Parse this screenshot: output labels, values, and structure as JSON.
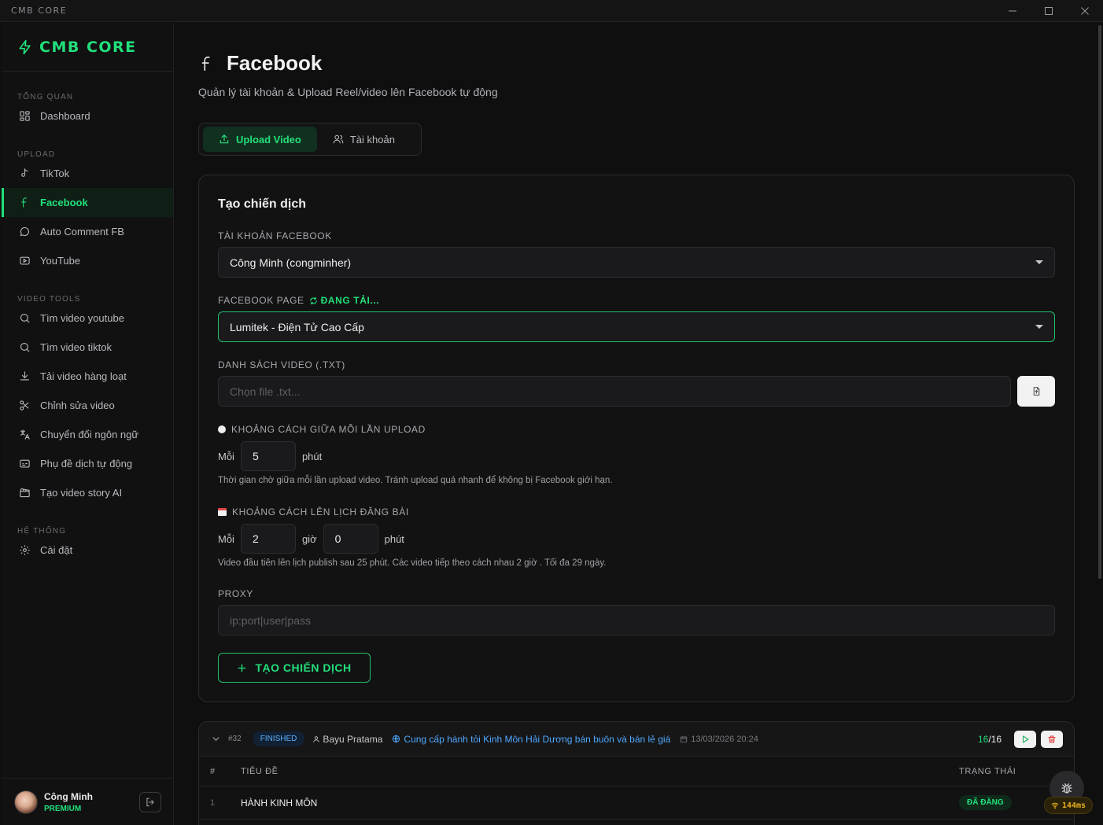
{
  "window": {
    "title": "CMB CORE"
  },
  "brand": {
    "name": "CMB CORE",
    "accent": "#22e07a"
  },
  "sidebar": {
    "sections": [
      {
        "label": "TỔNG QUAN",
        "items": [
          {
            "label": "Dashboard",
            "icon": "dashboard-icon"
          }
        ]
      },
      {
        "label": "UPLOAD",
        "items": [
          {
            "label": "TikTok",
            "icon": "tiktok-icon"
          },
          {
            "label": "Facebook",
            "icon": "facebook-icon",
            "active": true
          },
          {
            "label": "Auto Comment FB",
            "icon": "comment-icon"
          },
          {
            "label": "YouTube",
            "icon": "youtube-icon"
          }
        ]
      },
      {
        "label": "VIDEO TOOLS",
        "items": [
          {
            "label": "Tìm video youtube",
            "icon": "search-icon"
          },
          {
            "label": "Tìm video tiktok",
            "icon": "search-icon"
          },
          {
            "label": "Tải video hàng loạt",
            "icon": "download-icon"
          },
          {
            "label": "Chỉnh sửa video",
            "icon": "scissors-icon"
          },
          {
            "label": "Chuyển đổi ngôn ngữ",
            "icon": "translate-icon"
          },
          {
            "label": "Phụ đề dịch tự động",
            "icon": "subtitles-icon"
          },
          {
            "label": "Tạo video story AI",
            "icon": "clapperboard-icon"
          }
        ]
      },
      {
        "label": "HỆ THỐNG",
        "items": [
          {
            "label": "Cài đặt",
            "icon": "gear-icon"
          }
        ]
      }
    ]
  },
  "user": {
    "name": "Công Minh",
    "tier": "PREMIUM"
  },
  "page": {
    "title": "Facebook",
    "subtitle": "Quản lý tài khoản & Upload Reel/video lên Facebook tự động"
  },
  "tabs": [
    {
      "label": "Upload Video",
      "active": true
    },
    {
      "label": "Tài khoản",
      "active": false
    }
  ],
  "form": {
    "title": "Tạo chiến dịch",
    "account_label": "TÀI KHOẢN FACEBOOK",
    "account_value": "Công Minh (congminher)",
    "page_label": "FACEBOOK PAGE",
    "page_loading": "ĐANG TẢI...",
    "page_value": "Lumitek - Điện Tử Cao Cấp",
    "video_list_label": "DANH SÁCH VIDEO (.TXT)",
    "video_list_placeholder": "Chọn file .txt...",
    "interval_label": "KHOẢNG CÁCH GIỮA MỖI LẦN UPLOAD",
    "interval_prefix": "Mỗi",
    "interval_value": "5",
    "interval_unit": "phút",
    "interval_hint": "Thời gian chờ giữa mỗi lần upload video. Tránh upload quá nhanh để không bị Facebook giới hạn.",
    "schedule_label": "KHOẢNG CÁCH LÊN LỊCH ĐĂNG BÀI",
    "schedule_prefix": "Mỗi",
    "schedule_hours": "2",
    "schedule_hours_unit": "giờ",
    "schedule_minutes": "0",
    "schedule_minutes_unit": "phút",
    "schedule_hint": "Video đầu tiên lên lịch publish sau 25 phút. Các video tiếp theo cách nhau 2 giờ . Tối đa 29 ngày.",
    "proxy_label": "PROXY",
    "proxy_placeholder": "ip:port|user|pass",
    "create_button": "TẠO CHIẾN DỊCH"
  },
  "campaign": {
    "id": "#32",
    "status": "FINISHED",
    "user": "Bayu Pratama",
    "page": "Cung cấp hành tỏi Kinh Môn Hải Dương bán buôn và bán lẻ giá",
    "time": "13/03/2026 20:24",
    "done": "16",
    "total": "/16",
    "columns": {
      "num": "#",
      "title": "TIÊU ĐỀ",
      "status": "TRẠNG THÁI"
    },
    "rows": [
      {
        "num": "1",
        "title": "HÀNH KINH MÔN",
        "status": "ĐÃ ĐĂNG"
      }
    ]
  },
  "debug": {
    "ping": "144ms"
  }
}
